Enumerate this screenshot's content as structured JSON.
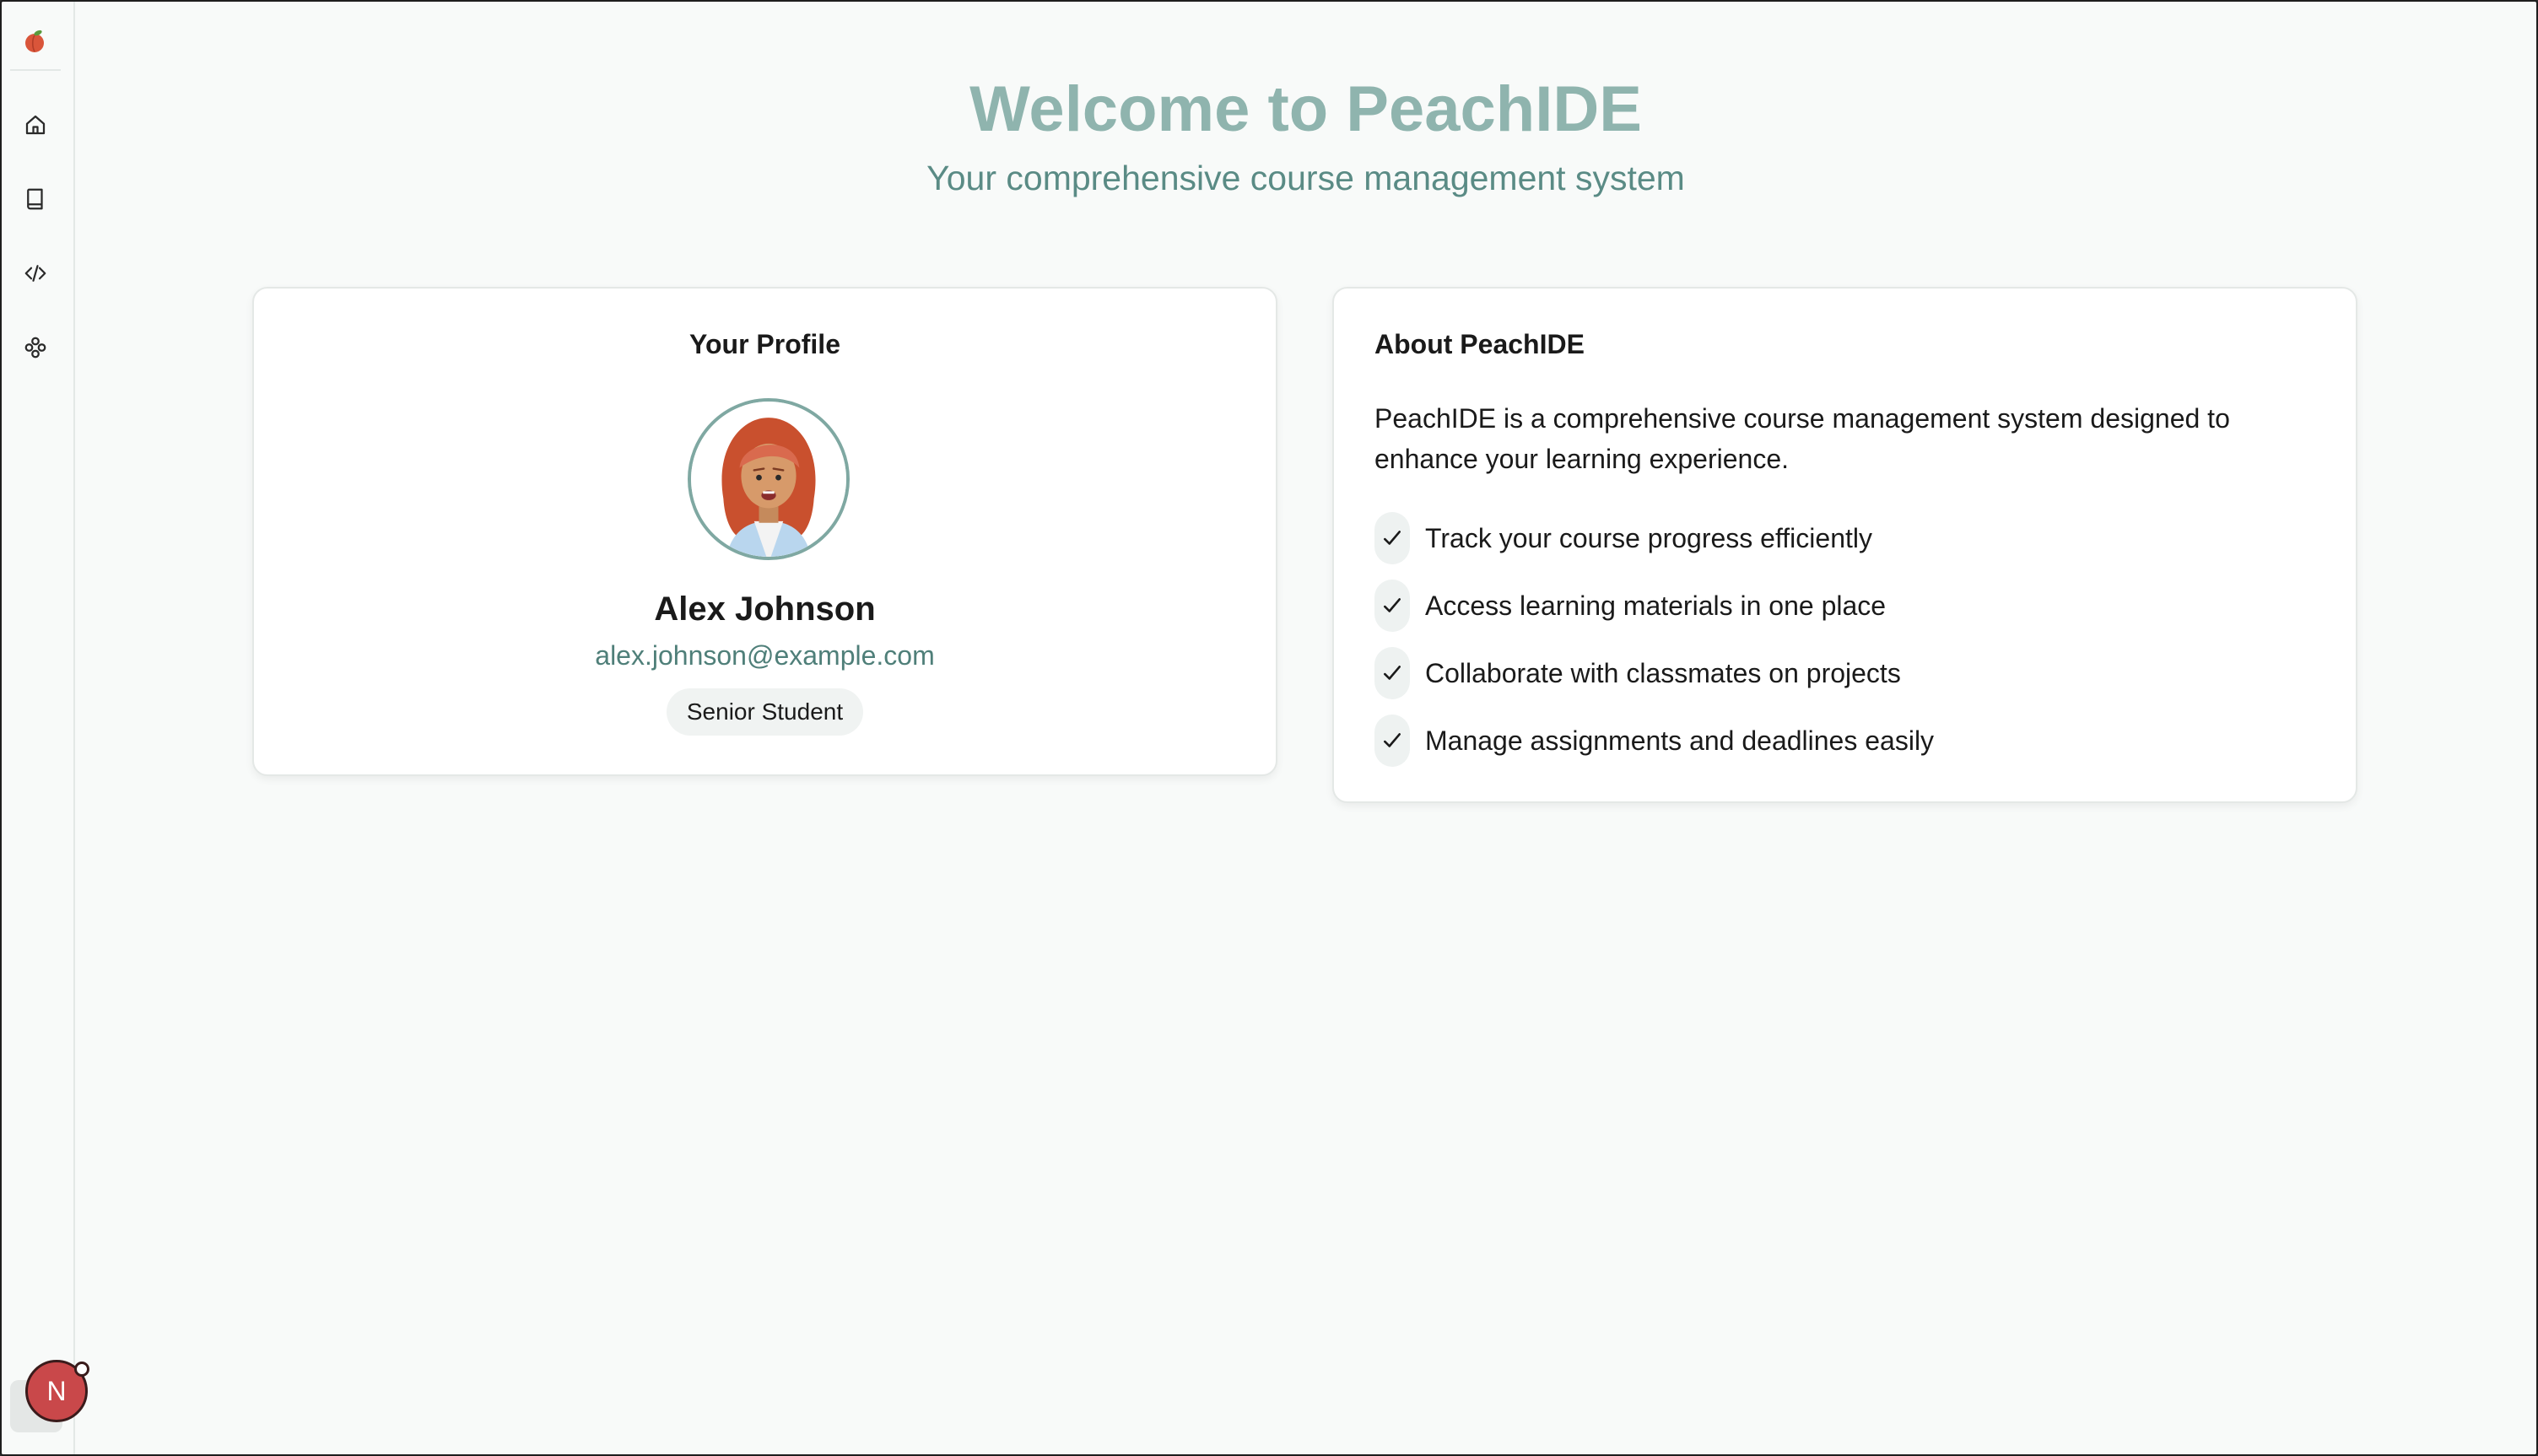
{
  "sidebar": {
    "logo": "peach-logo-icon",
    "items": [
      {
        "icon": "home-icon"
      },
      {
        "icon": "book-icon"
      },
      {
        "icon": "code-icon"
      },
      {
        "icon": "apps-icon"
      }
    ],
    "user_initial": "N"
  },
  "header": {
    "title": "Welcome to PeachIDE",
    "subtitle": "Your comprehensive course management system"
  },
  "profile": {
    "heading": "Your Profile",
    "name": "Alex Johnson",
    "email": "alex.johnson@example.com",
    "role": "Senior Student"
  },
  "about": {
    "heading": "About PeachIDE",
    "description": "PeachIDE is a comprehensive course management system designed to enhance your learning experience.",
    "features": [
      "Track your course progress efficiently",
      "Access learning materials in one place",
      "Collaborate with classmates on projects",
      "Manage assignments and deadlines easily"
    ]
  },
  "colors": {
    "accent": "#8fb4ae",
    "accent_dark": "#4f7f79",
    "avatar_ring": "#7fa8a2",
    "user_avatar": "#c9484a"
  }
}
